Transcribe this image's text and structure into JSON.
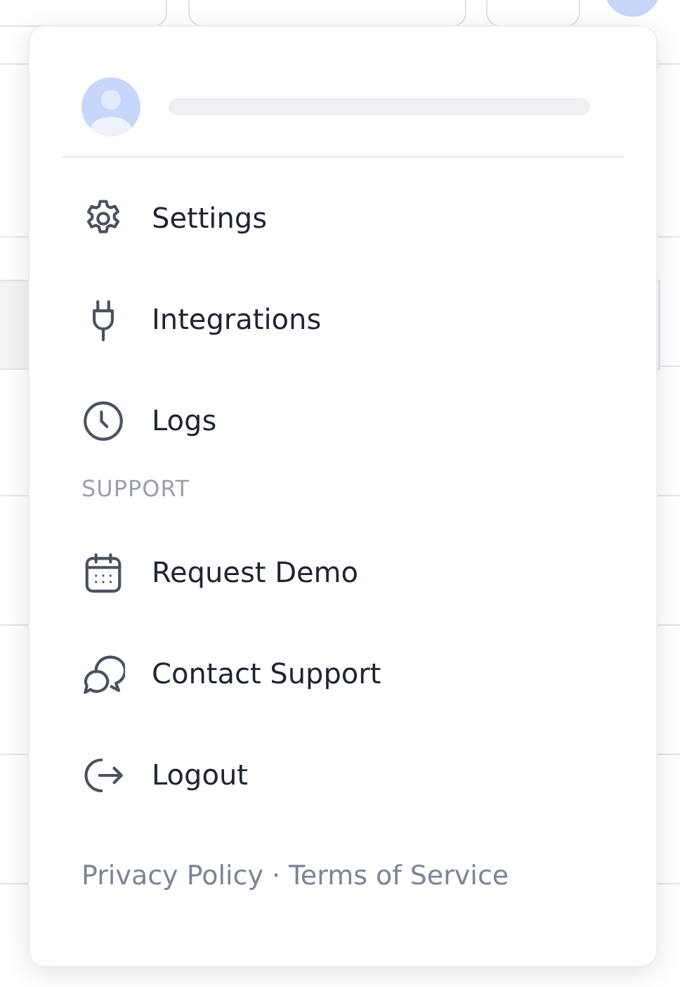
{
  "menu_items": [
    {
      "label": "Settings"
    },
    {
      "label": "Integrations"
    },
    {
      "label": "Logs"
    }
  ],
  "support": {
    "heading": "SUPPORT",
    "items": [
      {
        "label": "Request Demo"
      },
      {
        "label": "Contact Support"
      },
      {
        "label": "Logout"
      }
    ]
  },
  "footer": {
    "links": [
      "Privacy Policy",
      "Terms of Service"
    ],
    "separator": "·"
  }
}
